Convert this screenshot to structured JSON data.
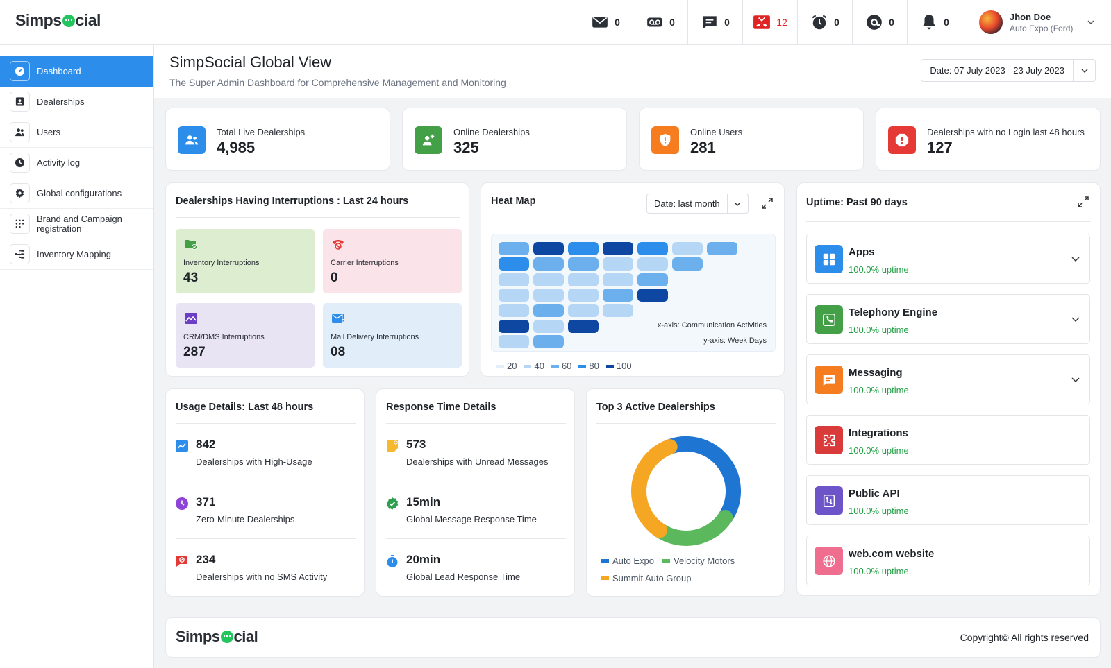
{
  "app": {
    "logo_prefix": "Simps",
    "logo_suffix": "cial"
  },
  "topbar": {
    "counters": [
      {
        "icon": "mail-icon",
        "value": "0"
      },
      {
        "icon": "voicemail-icon",
        "value": "0"
      },
      {
        "icon": "chat-icon",
        "value": "0"
      },
      {
        "icon": "missed-call-icon",
        "value": "12",
        "color": "#e02424"
      },
      {
        "icon": "alarm-icon",
        "value": "0"
      },
      {
        "icon": "at-mention-icon",
        "value": "0"
      },
      {
        "icon": "bell-icon",
        "value": "0"
      }
    ],
    "user": {
      "name": "Jhon Doe",
      "org": "Auto Expo (Ford)"
    }
  },
  "sidebar": {
    "items": [
      {
        "label": "Dashboard",
        "active": true
      },
      {
        "label": "Dealerships"
      },
      {
        "label": "Users"
      },
      {
        "label": "Activity log"
      },
      {
        "label": "Global configurations"
      },
      {
        "label": "Brand and Campaign registration"
      },
      {
        "label": "Inventory Mapping"
      }
    ]
  },
  "header": {
    "title": "SimpSocial Global View",
    "subtitle": "The Super Admin Dashboard for Comprehensive Management and Monitoring",
    "date_range": "Date: 07 July 2023 - 23 July 2023"
  },
  "stats": [
    {
      "label": "Total Live Dealerships",
      "value": "4,985",
      "color": "#2c8eea"
    },
    {
      "label": "Online Dealerships",
      "value": "325",
      "color": "#43a047"
    },
    {
      "label": "Online Users",
      "value": "281",
      "color": "#f57c1f"
    },
    {
      "label": "Dealerships with no Login last 48 hours",
      "value": "127",
      "color": "#e53935"
    }
  ],
  "interruptions": {
    "title": "Dealerships Having Interruptions : Last 24 hours",
    "items": [
      {
        "label": "Inventory Interruptions",
        "value": "43",
        "bg": "#dcedd0"
      },
      {
        "label": "Carrier Interruptions",
        "value": "0",
        "bg": "#fbe3ea"
      },
      {
        "label": "CRM/DMS Interruptions",
        "value": "287",
        "bg": "#e9e4f4"
      },
      {
        "label": "Mail Delivery Interruptions",
        "value": "08",
        "bg": "#e1eefa"
      }
    ]
  },
  "heatmap": {
    "title": "Heat Map",
    "filter": "Date: last month",
    "x_axis_note": "x-axis: Communication Activities",
    "y_axis_note": "y-axis: Week Days",
    "legend": [
      "20",
      "40",
      "60",
      "80",
      "100"
    ],
    "legend_colors": [
      "#e3eef9",
      "#b5d6f5",
      "#6bb0ec",
      "#2c8eea",
      "#0d47a1"
    ],
    "rows": [
      [
        60,
        100,
        80,
        100,
        80,
        40,
        60
      ],
      [
        80,
        60,
        60,
        40,
        40,
        60
      ],
      [
        40,
        40,
        40,
        40,
        60
      ],
      [
        40,
        40,
        40,
        60,
        100
      ],
      [
        40,
        60,
        40,
        40
      ],
      [
        100,
        40,
        100
      ],
      [
        40,
        60
      ]
    ]
  },
  "uptime": {
    "title": "Uptime: Past 90 days",
    "items": [
      {
        "name": "Apps",
        "status": "100.0% uptime",
        "color": "#2c8eea",
        "icon": "apps-grid-icon",
        "expandable": true
      },
      {
        "name": "Telephony Engine",
        "status": "100.0% uptime",
        "color": "#43a047",
        "icon": "phone-icon",
        "expandable": true
      },
      {
        "name": "Messaging",
        "status": "100.0% uptime",
        "color": "#f57c1f",
        "icon": "message-icon",
        "expandable": true
      },
      {
        "name": "Integrations",
        "status": "100.0% uptime",
        "color": "#d93a3a",
        "icon": "puzzle-icon",
        "expandable": false
      },
      {
        "name": "Public API",
        "status": "100.0% uptime",
        "color": "#6d55c9",
        "icon": "api-icon",
        "expandable": false
      },
      {
        "name": "web.com website",
        "status": "100.0% uptime",
        "color": "#ef6e8f",
        "icon": "globe-icon",
        "expandable": false
      }
    ]
  },
  "usage": {
    "title": "Usage Details: Last 48 hours",
    "items": [
      {
        "value": "842",
        "label": "Dealerships with High-Usage",
        "color": "#2c8eea"
      },
      {
        "value": "371",
        "label": "Zero-Minute Dealerships",
        "color": "#8e44d6"
      },
      {
        "value": "234",
        "label": "Dealerships with no SMS Activity",
        "color": "#e53935"
      }
    ]
  },
  "response": {
    "title": "Response Time Details",
    "items": [
      {
        "value": "573",
        "label": "Dealerships with Unread Messages",
        "color": "#f5b82e"
      },
      {
        "value": "15min",
        "label": "Global Message Response Time",
        "color": "#2e9e4f"
      },
      {
        "value": "20min",
        "label": "Global Lead Response Time",
        "color": "#2c8eea"
      }
    ]
  },
  "top_dealerships": {
    "title": "Top 3 Active Dealerships",
    "legend": [
      {
        "name": "Auto Expo",
        "color": "#1e76d2"
      },
      {
        "name": "Velocity Motors",
        "color": "#5cb85c"
      },
      {
        "name": "Summit Auto Group",
        "color": "#f5a623"
      }
    ]
  },
  "chart_data": {
    "type": "pie",
    "categories": [
      "Auto Expo",
      "Velocity Motors",
      "Summit Auto Group"
    ],
    "values": [
      40,
      25,
      35
    ]
  },
  "footer": {
    "copyright": "Copyright© All rights reserved"
  }
}
